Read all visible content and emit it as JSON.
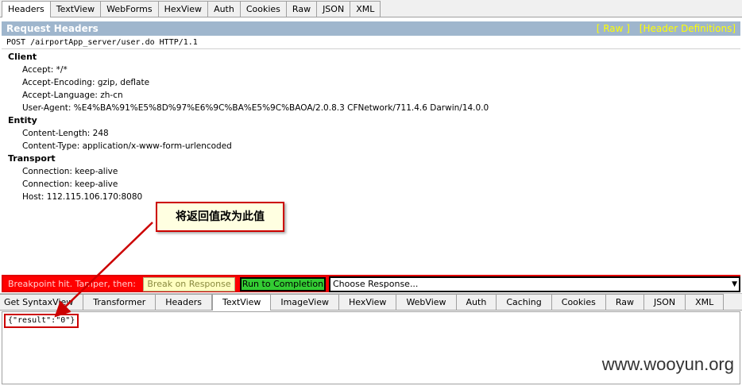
{
  "top_tabs": [
    "Headers",
    "TextView",
    "WebForms",
    "HexView",
    "Auth",
    "Cookies",
    "Raw",
    "JSON",
    "XML"
  ],
  "request_headers": {
    "title": "Request Headers",
    "raw_link": "[ Raw ]",
    "definitions_link": "[Header Definitions]",
    "request_line": "POST /airportApp_server/user.do HTTP/1.1",
    "groups": [
      {
        "name": "Client",
        "headers": [
          "Accept: */*",
          "Accept-Encoding: gzip, deflate",
          "Accept-Language: zh-cn",
          "User-Agent: %E4%BA%91%E5%8D%97%E6%9C%BA%E5%9C%BAOA/2.0.8.3 CFNetwork/711.4.6 Darwin/14.0.0"
        ]
      },
      {
        "name": "Entity",
        "headers": [
          "Content-Length: 248",
          "Content-Type: application/x-www-form-urlencoded"
        ]
      },
      {
        "name": "Transport",
        "headers": [
          "Connection: keep-alive",
          "Connection: keep-alive",
          "Host: 112.115.106.170:8080"
        ]
      }
    ]
  },
  "annotation": "将返回值改为此值",
  "breakpoint": {
    "text": "Breakpoint hit. Tamper, then:",
    "break_on_response": "Break on Response",
    "run_to_completion": "Run to Completion",
    "choose_response": "Choose Response..."
  },
  "bottom_tabs": [
    "Get SyntaxView",
    "Transformer",
    "Headers",
    "TextView",
    "ImageView",
    "HexView",
    "WebView",
    "Auth",
    "Caching",
    "Cookies",
    "Raw",
    "JSON",
    "XML"
  ],
  "response_text": "{\"result\":\"0\"}",
  "watermark": "www.wooyun.org",
  "colors": {
    "header_bar": "#9fb6cd",
    "breakpoint_bar": "#ff0000",
    "run_button": "#33cc33",
    "annotation_border": "#cc0000"
  }
}
